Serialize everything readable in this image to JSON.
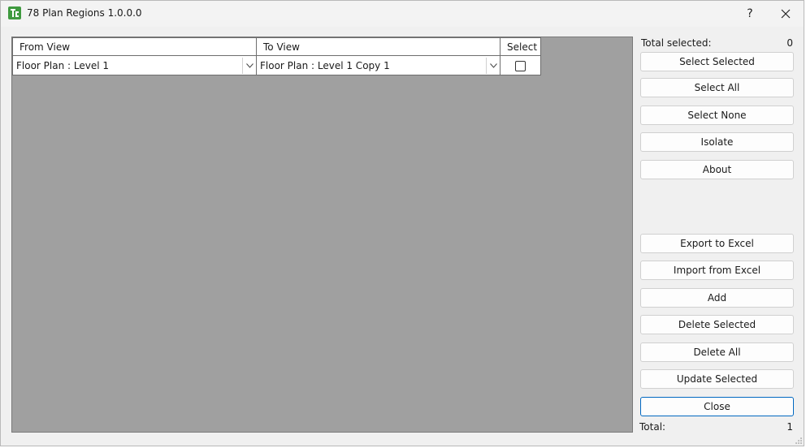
{
  "window": {
    "title": "78 Plan Regions 1.0.0.0",
    "help_glyph": "?",
    "icon": "app-logo-icon"
  },
  "grid": {
    "columns": [
      "From View",
      "To View",
      "Select"
    ],
    "rows": [
      {
        "from_view": "Floor Plan : Level 1",
        "to_view": "Floor Plan : Level 1 Copy 1",
        "selected": false
      }
    ]
  },
  "sidebar": {
    "total_selected_label": "Total selected:",
    "total_selected_value": "0",
    "buttons_top": [
      "Select Selected",
      "Select All",
      "Select None",
      "Isolate",
      "About"
    ],
    "buttons_bottom": [
      "Export to Excel",
      "Import from Excel",
      "Add",
      "Delete Selected",
      "Delete All",
      "Update Selected",
      "Close"
    ],
    "total_label": "Total:",
    "total_value": "1"
  },
  "colors": {
    "grid_background": "#a0a0a0",
    "default_button_border": "#0067c0",
    "logo_green": "#3f9a3f"
  }
}
